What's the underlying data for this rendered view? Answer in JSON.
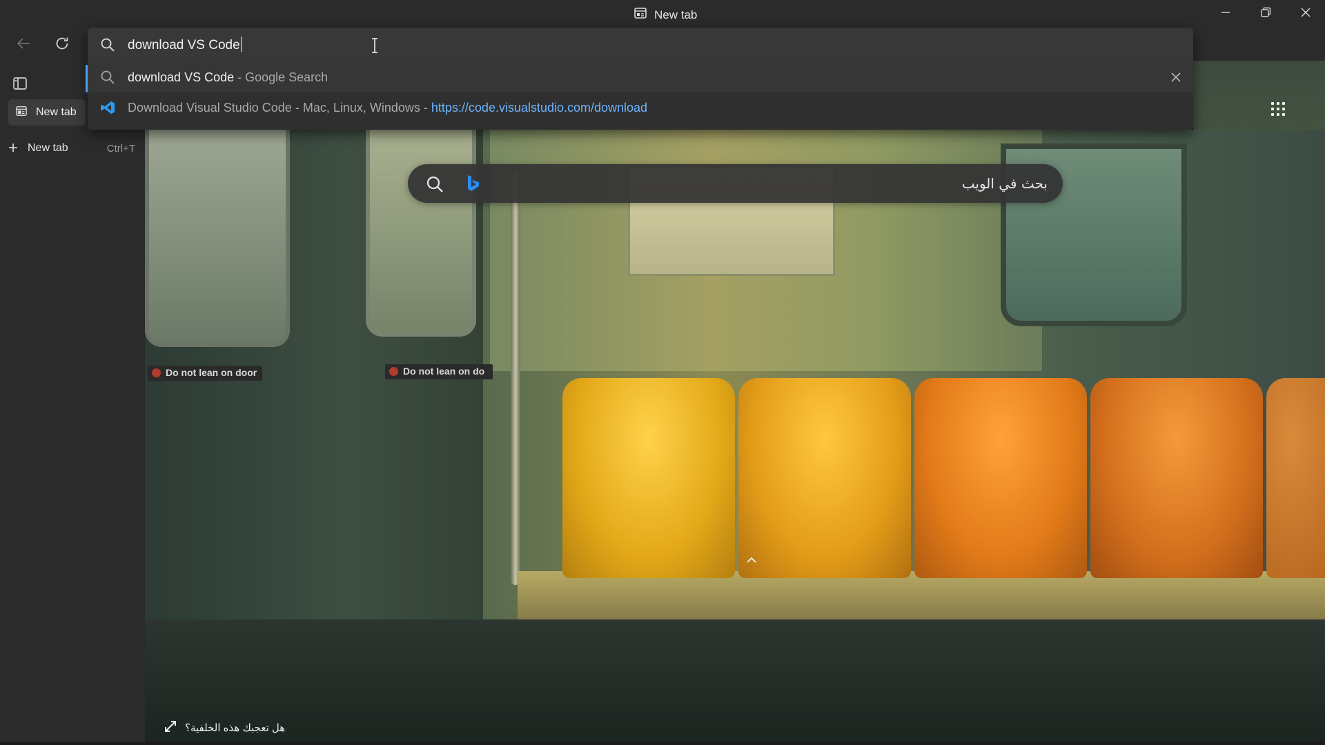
{
  "window": {
    "title": "New tab",
    "title_icon": "tab-page-icon",
    "controls": [
      "minimize-icon",
      "restore-icon",
      "close-icon"
    ]
  },
  "toolbar": {
    "back_icon": "arrow-left-icon",
    "refresh_icon": "refresh-icon",
    "extensions_icon": "puzzle-icon",
    "profile_icon": "avatar",
    "more_icon": "ellipsis-icon"
  },
  "address_bar": {
    "value": "download VS Code",
    "suggestions": [
      {
        "icon": "search-icon",
        "main": "download VS Code",
        "separator": " - ",
        "sub": "Google Search"
      },
      {
        "icon": "vscode-icon",
        "main": "Download Visual Studio Code - Mac, Linux, Windows",
        "separator": " - ",
        "url": "https://code.visualstudio.com/download"
      }
    ]
  },
  "sidebar": {
    "toggle_icon": "vertical-tabs-icon",
    "tabs": [
      {
        "label": "New tab",
        "icon": "tab-page-icon",
        "active": true
      }
    ],
    "new_tab": {
      "label": "New tab",
      "shortcut": "Ctrl+T"
    }
  },
  "page": {
    "web_search_placeholder": "بحث في الويب",
    "apps_icon": "apps-grid-icon",
    "background_prompt": "هل تعجبك هذه الخلفية؟",
    "signs": [
      "Do not lean on door",
      "Do not lean on do"
    ],
    "accent_color": "#4f9ff0",
    "link_color": "#6cb4ff"
  }
}
